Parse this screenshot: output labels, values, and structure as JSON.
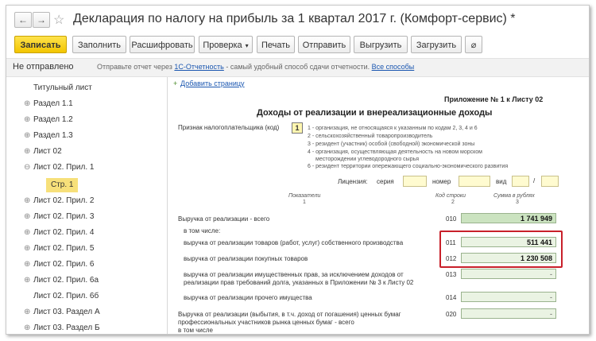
{
  "window": {
    "title": "Декларация по налогу на прибыль за 1 квартал 2017 г. (Комфорт-сервис) *",
    "nav_back": "←",
    "nav_forward": "→",
    "favorite": "☆"
  },
  "toolbar": {
    "save": "Записать",
    "fill": "Заполнить",
    "decode": "Расшифровать",
    "check": "Проверка",
    "print": "Печать",
    "send": "Отправить",
    "upload": "Выгрузить",
    "download": "Загрузить",
    "attach": "⌀"
  },
  "infobar": {
    "status": "Не отправлено",
    "hint_prefix": "Отправьте отчет через",
    "hint_link1": "1С-Отчетность",
    "hint_middle": "- самый удобный способ сдачи отчетности.",
    "hint_link2": "Все способы"
  },
  "sidebar": {
    "items": [
      {
        "label": "Титульный лист",
        "expander": ""
      },
      {
        "label": "Раздел 1.1",
        "expander": "⊕"
      },
      {
        "label": "Раздел 1.2",
        "expander": "⊕"
      },
      {
        "label": "Раздел 1.3",
        "expander": "⊕"
      },
      {
        "label": "Лист 02",
        "expander": "⊕"
      },
      {
        "label": "Лист 02. Прил. 1",
        "expander": "⊖"
      },
      {
        "label": "Стр. 1",
        "expander": ""
      },
      {
        "label": "Лист 02. Прил. 2",
        "expander": "⊕"
      },
      {
        "label": "Лист 02. Прил. 3",
        "expander": "⊕"
      },
      {
        "label": "Лист 02. Прил. 4",
        "expander": "⊕"
      },
      {
        "label": "Лист 02. Прил. 5",
        "expander": "⊕"
      },
      {
        "label": "Лист 02. Прил. 6",
        "expander": "⊕"
      },
      {
        "label": "Лист 02. Прил. 6а",
        "expander": "⊕"
      },
      {
        "label": "Лист 02. Прил. 6б",
        "expander": ""
      },
      {
        "label": "Лист 03. Раздел А",
        "expander": "⊕"
      },
      {
        "label": "Лист 03. Раздел Б",
        "expander": "⊕"
      }
    ]
  },
  "form": {
    "add_page": "Добавить страницу",
    "appendix": "Приложение № 1 к Листу 02",
    "heading": "Доходы от реализации и внереализационные доходы",
    "taxpayer_label": "Признак налогоплательщика (код)",
    "taxpayer_code": "1",
    "codes": [
      "1 - организация, не относящаяся к указанным по кодам 2, 3, 4 и 6",
      "2 - сельскохозяйственный товаропроизводитель",
      "3 - резидент (участник) особой (свободной) экономической зоны",
      "4 - организация, осуществляющая деятельность на новом морском",
      "месторождении углеводородного сырья",
      "6 - резидент территории опережающего социально-экономического развития"
    ],
    "license_label": "Лицензия:",
    "series_label": "серия",
    "number_label": "номер",
    "kind_label": "вид",
    "slash": "/",
    "col_indicators": "Показатели",
    "col_indicators_num": "1",
    "col_code": "Код строки",
    "col_code_num": "2",
    "col_sum": "Сумма в рублях",
    "col_sum_num": "3",
    "rows": [
      {
        "label": "Выручка от реализации - всего",
        "code": "010",
        "value": "1 741 949"
      },
      {
        "label": "в том числе:",
        "code": "",
        "value": ""
      },
      {
        "label": "выручка от реализации товаров (работ, услуг) собственного производства",
        "code": "011",
        "value": "511 441"
      },
      {
        "label": "выручка от реализации покупных товаров",
        "code": "012",
        "value": "1 230 508"
      },
      {
        "label": "выручка от реализации имущественных прав, за исключением доходов от",
        "label2": "реализации прав требований долга, указанных в Приложении № 3 к Листу 02",
        "code": "013",
        "value": "-"
      },
      {
        "label": "выручка от реализации прочего имущества",
        "code": "014",
        "value": "-"
      },
      {
        "label": "Выручка от реализации (выбытия, в т.ч. доход от погашения) ценных бумаг",
        "label2": "профессиональных участников рынка ценных бумаг - всего",
        "label3": "в том числе",
        "code": "020",
        "value": "-"
      }
    ]
  }
}
